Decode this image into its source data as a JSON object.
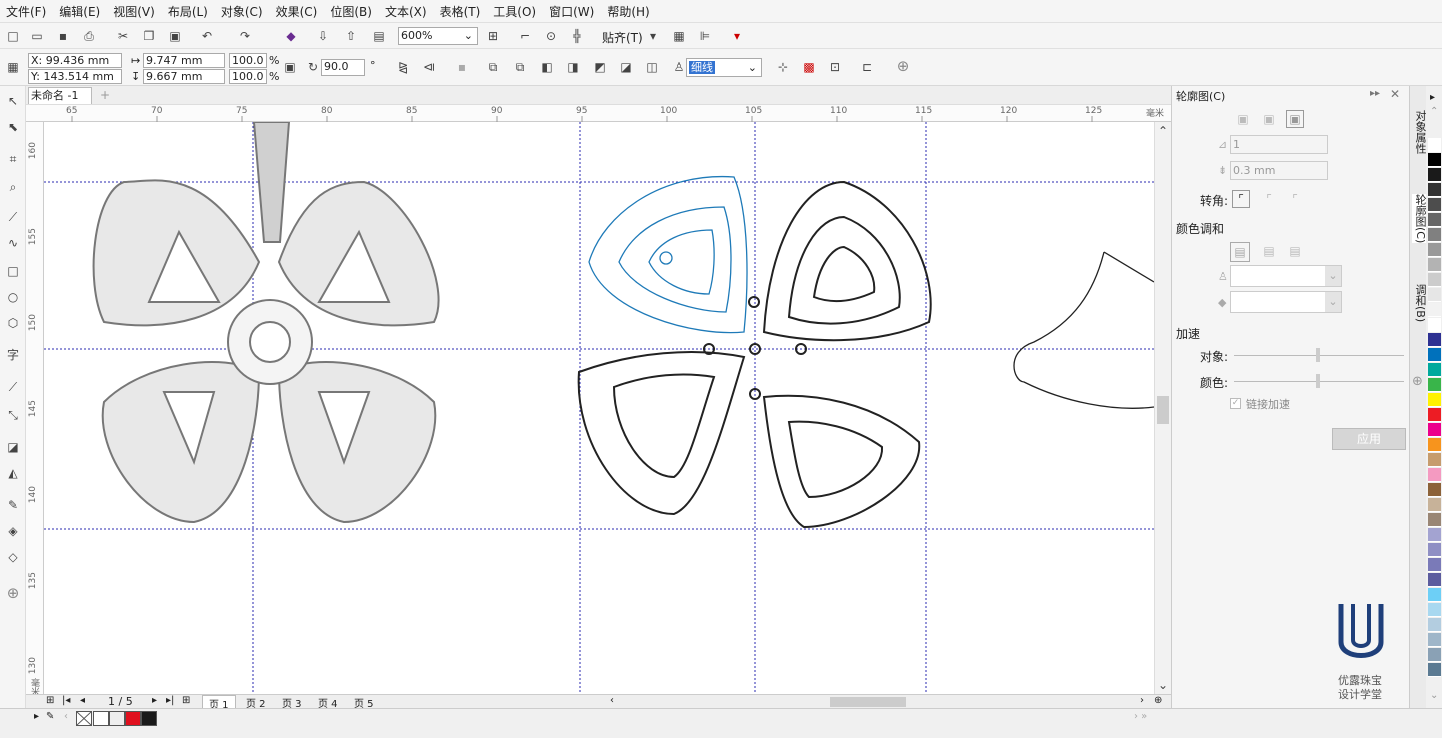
{
  "menu": [
    "文件(F)",
    "编辑(E)",
    "视图(V)",
    "布局(L)",
    "对象(C)",
    "效果(C)",
    "位图(B)",
    "文本(X)",
    "表格(T)",
    "工具(O)",
    "窗口(W)",
    "帮助(H)"
  ],
  "toolbar": {
    "zoom": "600%",
    "snap": "贴齐(T)"
  },
  "props": {
    "x": "X: 99.436 mm",
    "y": "Y: 143.514 mm",
    "w": "9.747 mm",
    "h": "9.667 mm",
    "sx": "100.0",
    "sy": "100.0",
    "pct": "%",
    "angle": "90.0",
    "deg": "°",
    "outline": "细线"
  },
  "doc_tab": "未命名 -1",
  "hruler_ticks": [
    "65",
    "70",
    "75",
    "80",
    "85",
    "90",
    "95",
    "100",
    "105",
    "110",
    "115",
    "120",
    "125"
  ],
  "hruler_unit": "毫米",
  "vruler_ticks": [
    "160",
    "155",
    "150",
    "145",
    "140",
    "135",
    "130"
  ],
  "vruler_unit": "毫米",
  "pagebar": {
    "count": "1 / 5",
    "pages": [
      "页 1",
      "页 2",
      "页 3",
      "页 4",
      "页 5"
    ]
  },
  "panel": {
    "title": "轮廓图(C)",
    "steps": "1",
    "offset": "0.3 mm",
    "corner_label": "转角:",
    "blend_label": "颜色调和",
    "accel_label": "加速",
    "obj_label": "对象:",
    "color_label": "颜色:",
    "link_label": "链接加速",
    "apply": "应用"
  },
  "vtabs": [
    "对象属性",
    "轮廓图(C)",
    "调和(B)"
  ],
  "watermark": {
    "line1": "优露珠宝",
    "line2": "设计学堂"
  },
  "palette_colors": [
    "#ffffff",
    "#000000",
    "#1a1a1a",
    "#333333",
    "#4d4d4d",
    "#666666",
    "#808080",
    "#999999",
    "#b3b3b3",
    "#cccccc",
    "#e6e6e6",
    "#f2f2f2",
    "#ffffff",
    "#2e3192",
    "#0071bc",
    "#00a99d",
    "#39b54a",
    "#fff200",
    "#ed1c24",
    "#ec008c",
    "#f7941d",
    "#c69c6d",
    "#f49ac1",
    "#8c6239",
    "#c7b299",
    "#998675",
    "#a3a3d1",
    "#8f8fc4",
    "#7a7ab8",
    "#5c5c9e",
    "#6dcff6",
    "#a8d8f0",
    "#b3cde0",
    "#9fb6c9",
    "#8aa1b5",
    "#5b7a92"
  ]
}
